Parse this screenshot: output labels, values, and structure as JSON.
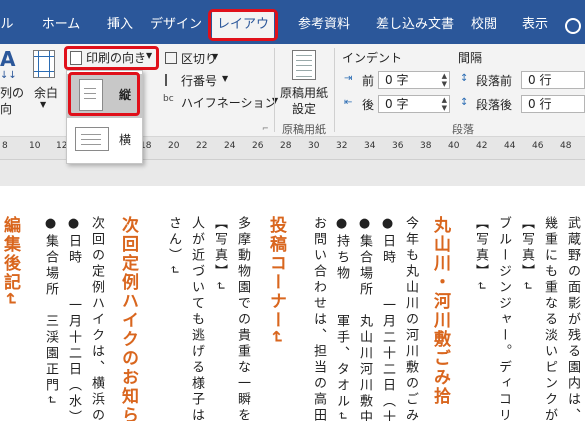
{
  "tabs": [
    {
      "label": "ル",
      "active": false
    },
    {
      "label": "ホーム",
      "active": false
    },
    {
      "label": "挿入",
      "active": false
    },
    {
      "label": "デザイン",
      "active": false
    },
    {
      "label": "レイアウト",
      "active": true
    },
    {
      "label": "参考資料",
      "active": false
    },
    {
      "label": "差し込み文書",
      "active": false
    },
    {
      "label": "校閲",
      "active": false
    },
    {
      "label": "表示",
      "active": false
    }
  ],
  "ribbon": {
    "text_direction_partial": "列の",
    "text_direction_partial2": "向",
    "margins_label": "余白",
    "orientation_label": "印刷の向き",
    "breaks_label": "区切り",
    "line_numbers_label": "行番号",
    "hyphenation_label": "ハイフネーション",
    "genko_label_1": "原稿用紙",
    "genko_label_2": "設定",
    "genko_group_label": "原稿用紙",
    "indent_label": "インデント",
    "spacing_label": "間隔",
    "indent_before_label": "前",
    "indent_after_label": "後",
    "indent_before_value": "0 字",
    "indent_after_value": "0 字",
    "spacing_before_label": "段落前",
    "spacing_after_label": "段落後",
    "spacing_before_value": "0 行",
    "spacing_after_value": "0 行",
    "paragraph_group_label": "段落"
  },
  "orientation_menu": {
    "items": [
      {
        "label": "縦",
        "selected": true
      },
      {
        "label": "横",
        "selected": false
      }
    ]
  },
  "ruler": {
    "ticks": [
      "8",
      "10",
      "12",
      "14",
      "16",
      "18",
      "20",
      "22",
      "24",
      "26",
      "28",
      "30",
      "32",
      "34",
      "36",
      "38",
      "40",
      "42",
      "44",
      "46",
      "48"
    ]
  },
  "document": {
    "columns": [
      {
        "text": "武蔵野の面影が残る園内は、四",
        "head": false
      },
      {
        "text": "幾重にも重なる淡いピンクが美",
        "head": false
      },
      {
        "text": "【写真】↵",
        "head": false
      },
      {
        "text": "ブルージンジャー。ディコリサ",
        "head": false
      },
      {
        "text": "【写真】↵",
        "head": false
      },
      {
        "text": "丸山川・河川敷ごみ拾",
        "head": true
      },
      {
        "text": "今年も丸山川の河川敷のごみ拾",
        "head": false
      },
      {
        "text": "●日時　　一月二十二日（十",
        "head": false
      },
      {
        "text": "●集合場所　丸山川河川敷中央",
        "head": false
      },
      {
        "text": "●持ち物　　軍手、タオル↵",
        "head": false
      },
      {
        "text": "お問い合わせは、担当の高田さ",
        "head": false
      },
      {
        "text": "投稿コーナー↵",
        "head": true
      },
      {
        "text": "多摩動物園での貴重な一瞬を撮",
        "head": false
      },
      {
        "text": "【写真】↵",
        "head": false
      },
      {
        "text": "人が近づいても逃げる様子はな",
        "head": false
      },
      {
        "text": "さん）↵",
        "head": false
      },
      {
        "text": "次回定例ハイクのお知ら",
        "head": true
      },
      {
        "text": "次回の定例ハイクは、横浜の三",
        "head": false
      },
      {
        "text": "●日時　　一月十二日（水）",
        "head": false
      },
      {
        "text": "●集合場所　三渓園正門↵",
        "head": false
      },
      {
        "text": "編集後記↵",
        "head": true
      }
    ]
  },
  "colors": {
    "ribbon_blue": "#2b579a",
    "highlight_red": "#e0101a",
    "heading_orange": "#d9661e"
  }
}
